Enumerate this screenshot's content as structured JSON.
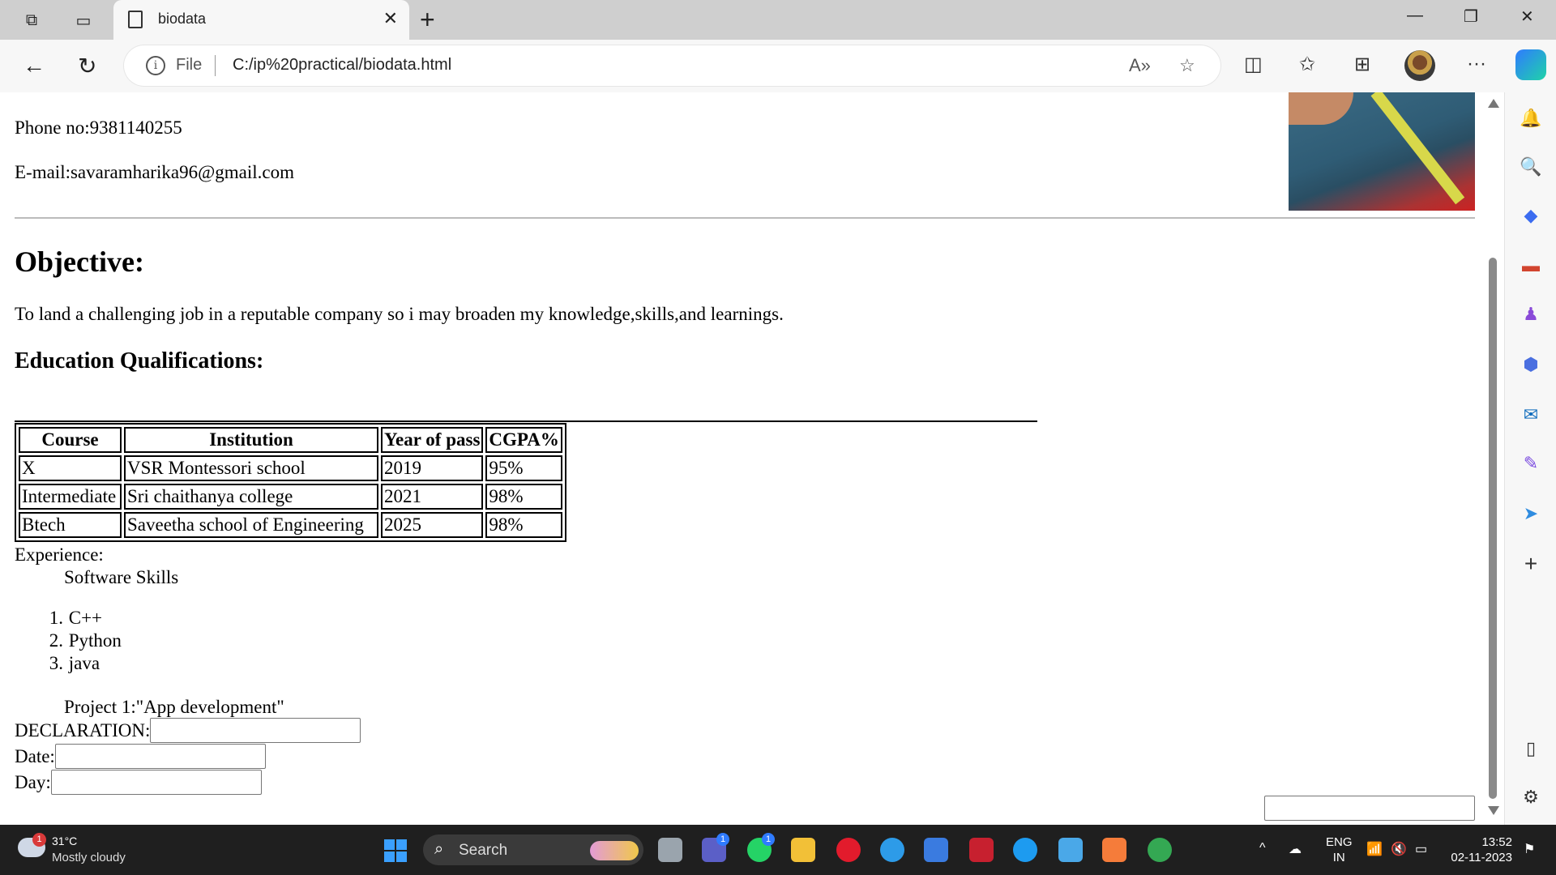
{
  "browser": {
    "tab_title": "biodata",
    "url_scheme": "File",
    "url": "C:/ip%20practical/biodata.html"
  },
  "page": {
    "phone": "Phone no:9381140255",
    "email": "E-mail:savaramharika96@gmail.com",
    "objective_heading": "Objective:",
    "objective_text": "To land a challenging job in a reputable company so i may broaden my knowledge,skills,and learnings.",
    "education_heading": "Education Qualifications:",
    "table": {
      "headers": [
        "Course",
        "Institution",
        "Year of pass",
        "CGPA%"
      ],
      "rows": [
        [
          "X",
          "VSR Montessori school",
          "2019",
          "95%"
        ],
        [
          "Intermediate",
          "Sri chaithanya college",
          "2021",
          "98%"
        ],
        [
          "Btech",
          "Saveetha school of Engineering",
          "2025",
          "98%"
        ]
      ]
    },
    "experience_label": "Experience:",
    "software_skills_label": "Software Skills",
    "skills": [
      {
        "num": "1.",
        "name": "C++"
      },
      {
        "num": "2.",
        "name": "Python"
      },
      {
        "num": "3.",
        "name": "java"
      }
    ],
    "project": "Project 1:\"App development\"",
    "declaration_label": "DECLARATION:",
    "date_label": "Date:",
    "day_label": "Day:"
  },
  "taskbar": {
    "weather_badge": "1",
    "temperature": "31°C",
    "condition": "Mostly cloudy",
    "search_label": "Search",
    "teams_badge": "1",
    "whatsapp_badge": "1",
    "lang_line1": "ENG",
    "lang_line2": "IN",
    "time": "13:52",
    "date": "02-11-2023"
  }
}
